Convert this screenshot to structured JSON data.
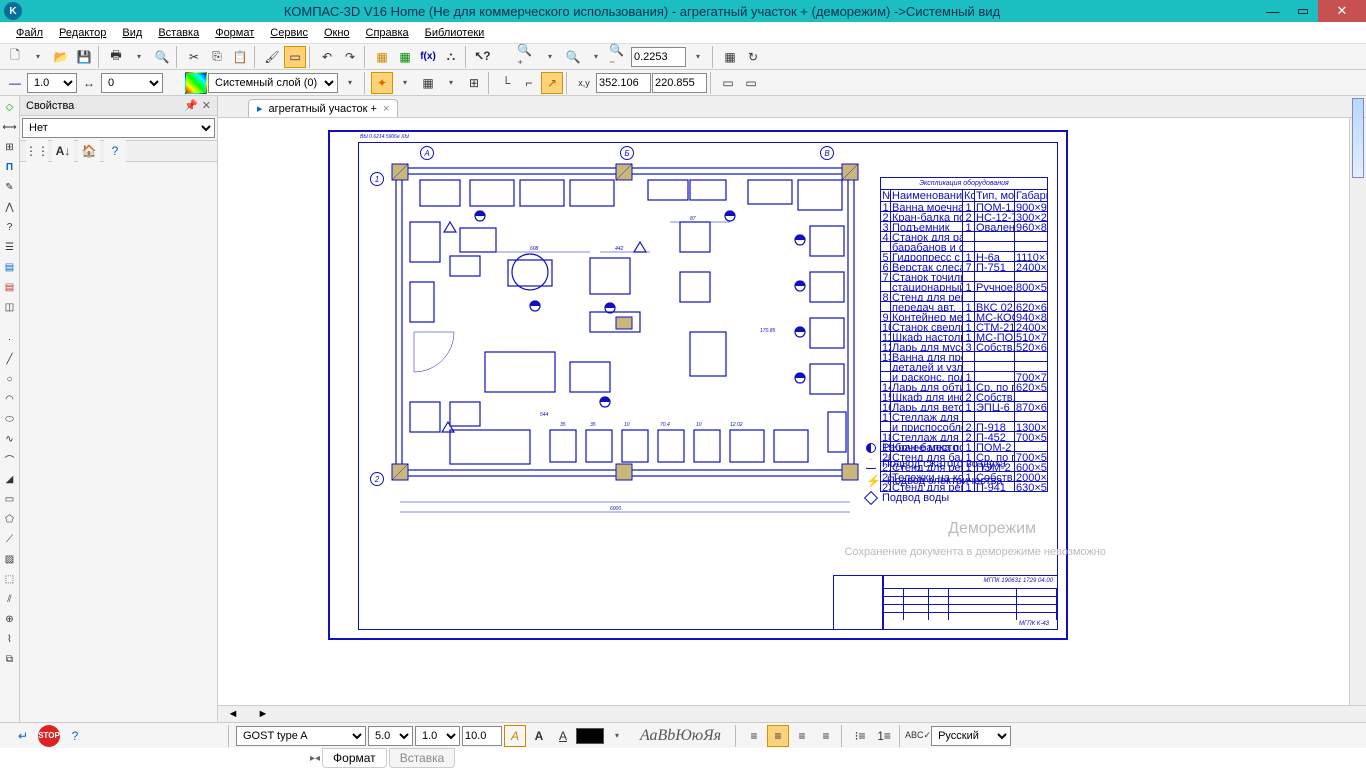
{
  "title": "КОМПАС-3D V16 Home  (Не для коммерческого использования) - агрегатный участок  + (деморежим) ->Системный вид",
  "menu": [
    "Файл",
    "Редактор",
    "Вид",
    "Вставка",
    "Формат",
    "Сервис",
    "Окно",
    "Справка",
    "Библиотеки"
  ],
  "toolbar1": {
    "zoom_value": "0.2253"
  },
  "toolbar2": {
    "line_width": "1.0",
    "offset": "0",
    "layer": "Системный слой (0)",
    "coord_x": "352.106",
    "coord_y": "220.855"
  },
  "props": {
    "title": "Свойства",
    "value": "Нет"
  },
  "doc_tab": {
    "name": "агрегатный участок  +"
  },
  "drawing": {
    "frame_label": "ВЫ 0.6214.5906е ХЫ",
    "spec_title": "Экспликация оборудования",
    "watermark1": "Деморежим",
    "watermark2": "Сохранение документа в деморежиме невозможно",
    "title_block_code": "МГПК 190631 1729 04.00",
    "title_block_org": "МГПК К-43",
    "axes_h": [
      "А",
      "Б",
      "В"
    ],
    "axes_v": [
      "1",
      "2"
    ],
    "legend": [
      "Рабочее место",
      "Подвод сжатого воздуха",
      "Подвод электричества",
      "Подвод воды"
    ]
  },
  "bottom": {
    "font": "GOST type A",
    "size1": "5.0",
    "size2": "1.0",
    "size3": "10.0",
    "sample": "АаВbЮюЯя",
    "lang": "Русский",
    "tab1": "Формат",
    "tab2": "Вставка"
  }
}
